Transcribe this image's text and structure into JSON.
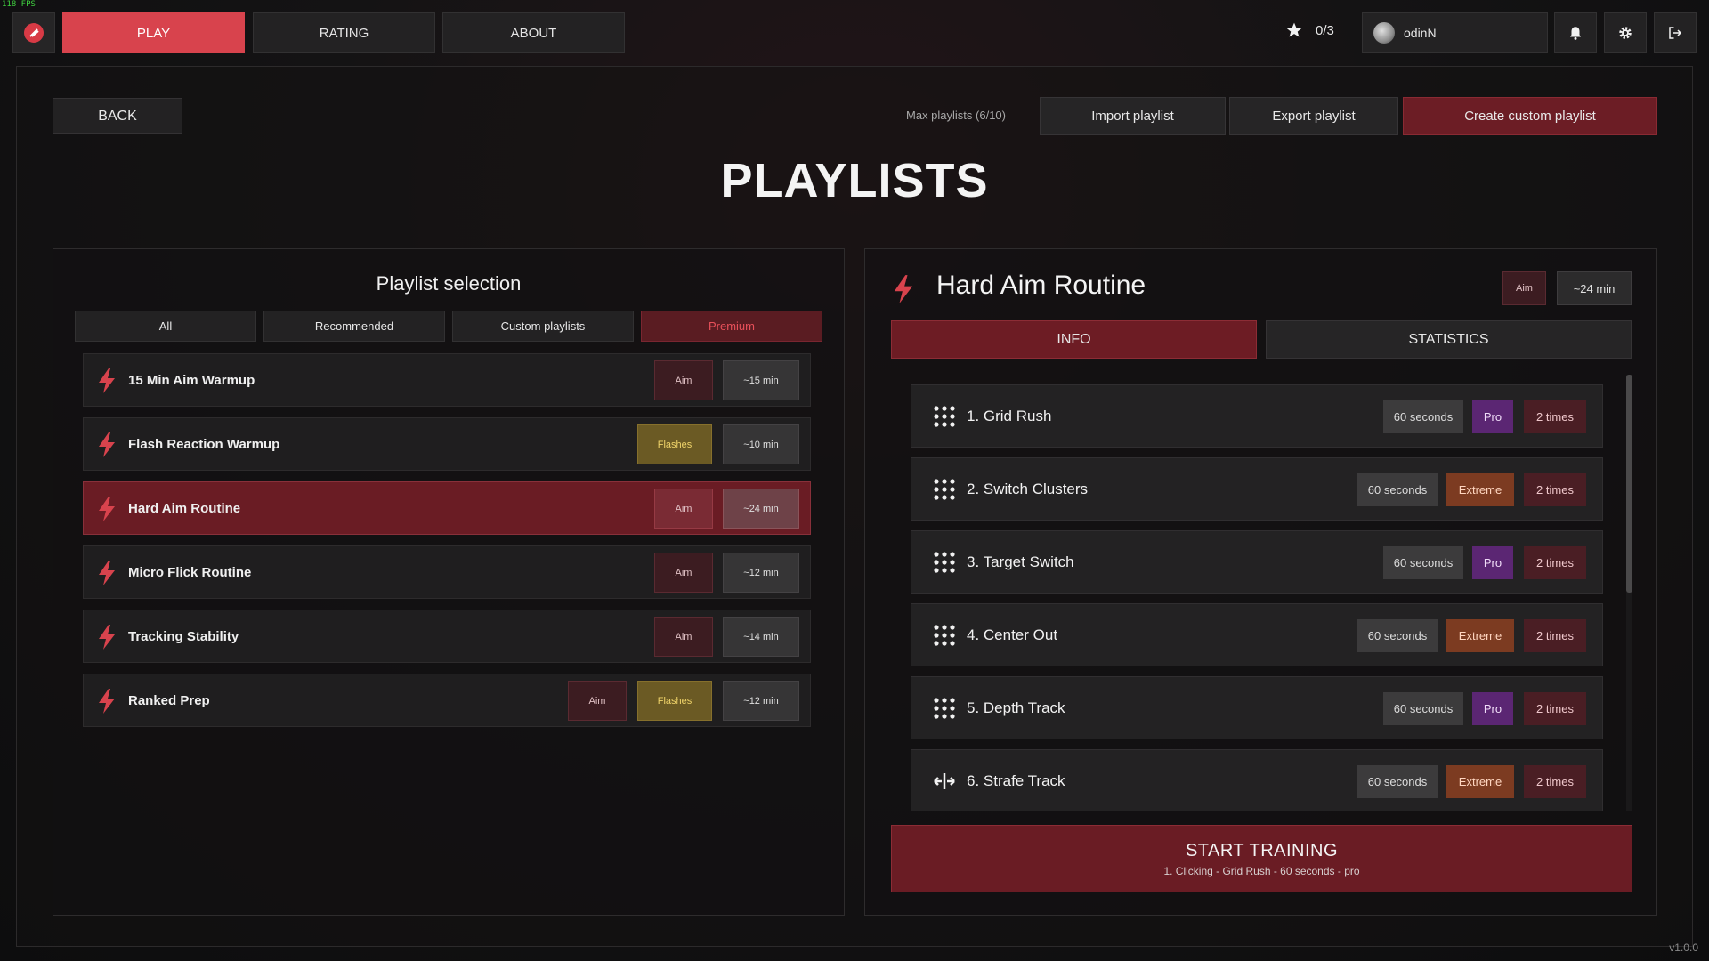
{
  "fps": "118 FPS",
  "version": "v1.0.0",
  "nav": {
    "tabs": [
      {
        "label": "PLAY",
        "active": true
      },
      {
        "label": "RATING",
        "active": false
      },
      {
        "label": "ABOUT",
        "active": false
      }
    ],
    "stars": "0/3",
    "username": "odinN"
  },
  "header": {
    "back_label": "BACK",
    "max_playlists": "Max playlists (6/10)",
    "import_label": "Import playlist",
    "export_label": "Export playlist",
    "create_label": "Create custom playlist",
    "page_title": "PLAYLISTS"
  },
  "selection": {
    "title": "Playlist selection",
    "filters": [
      "All",
      "Recommended",
      "Custom playlists",
      "Premium"
    ],
    "active_filter": "Premium",
    "playlists": [
      {
        "name": "15 Min Aim Warmup",
        "tags": [
          "Aim"
        ],
        "duration": "~15 min",
        "selected": false
      },
      {
        "name": "Flash Reaction Warmup",
        "tags": [
          "Flashes"
        ],
        "duration": "~10 min",
        "selected": false
      },
      {
        "name": "Hard Aim Routine",
        "tags": [
          "Aim"
        ],
        "duration": "~24 min",
        "selected": true
      },
      {
        "name": "Micro Flick Routine",
        "tags": [
          "Aim"
        ],
        "duration": "~12 min",
        "selected": false
      },
      {
        "name": "Tracking Stability",
        "tags": [
          "Aim"
        ],
        "duration": "~14 min",
        "selected": false
      },
      {
        "name": "Ranked Prep",
        "tags": [
          "Aim",
          "Flashes"
        ],
        "duration": "~12 min",
        "selected": false
      }
    ]
  },
  "detail": {
    "title": "Hard Aim Routine",
    "tag": "Aim",
    "duration": "~24 min",
    "tabs": [
      "INFO",
      "STATISTICS"
    ],
    "active_tab": "INFO",
    "tasks": [
      {
        "name": "1. Grid Rush",
        "icon": "grid-icon",
        "duration": "60 seconds",
        "difficulty": "Pro",
        "repeat": "2 times"
      },
      {
        "name": "2. Switch Clusters",
        "icon": "grid-icon",
        "duration": "60 seconds",
        "difficulty": "Extreme",
        "repeat": "2 times"
      },
      {
        "name": "3. Target Switch",
        "icon": "grid-icon",
        "duration": "60 seconds",
        "difficulty": "Pro",
        "repeat": "2 times"
      },
      {
        "name": "4. Center Out",
        "icon": "grid-icon",
        "duration": "60 seconds",
        "difficulty": "Extreme",
        "repeat": "2 times"
      },
      {
        "name": "5. Depth Track",
        "icon": "grid-icon",
        "duration": "60 seconds",
        "difficulty": "Pro",
        "repeat": "2 times"
      },
      {
        "name": "6. Strafe Track",
        "icon": "strafe-icon",
        "duration": "60 seconds",
        "difficulty": "Extreme",
        "repeat": "2 times"
      }
    ],
    "start_label": "START TRAINING",
    "start_sub": "1. Clicking - Grid Rush - 60 seconds - pro"
  },
  "colors": {
    "accent": "#d8434d",
    "selected_row": "#6a1c24",
    "pro": "#5b2673",
    "extreme": "#7c3b21",
    "flashes": "#6b5a24"
  }
}
